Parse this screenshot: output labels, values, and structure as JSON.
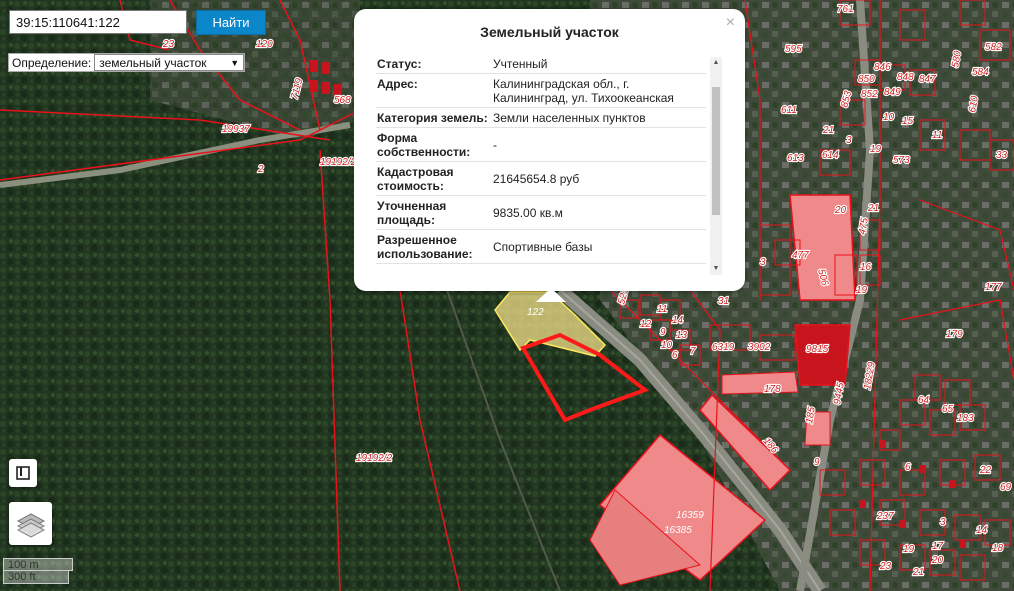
{
  "search": {
    "value": "39:15:110641:122",
    "button_label": "Найти"
  },
  "definition": {
    "label": "Определение:",
    "selected": "земельный участок"
  },
  "popup": {
    "title": "Земельный участок",
    "close": "×",
    "rows": [
      {
        "key": "Статус:",
        "value": "Учтенный"
      },
      {
        "key": "Адрес:",
        "value": "Калининградская обл., г. Калининград, ул. Тихоокеанская"
      },
      {
        "key": "Категория земель:",
        "value": "Земли населенных пунктов"
      },
      {
        "key": "Форма собственности:",
        "value": "-"
      },
      {
        "key": "Кадастровая стоимость:",
        "value": "21645654.8 руб"
      },
      {
        "key": "Уточненная площадь:",
        "value": "9835.00 кв.м"
      },
      {
        "key": "Разрешенное использование:",
        "value": "Спортивные базы"
      }
    ]
  },
  "map_labels": [
    "23",
    "120",
    "7119",
    "568",
    "19937",
    "19192/2",
    "2",
    "122",
    "19192/2",
    "595",
    "761",
    "611",
    "613",
    "614",
    "21",
    "3",
    "19",
    "573",
    "846",
    "848",
    "847",
    "850",
    "852",
    "849",
    "853",
    "10",
    "15",
    "11",
    "580",
    "582",
    "584",
    "33",
    "610",
    "20",
    "477",
    "506",
    "475",
    "16",
    "19",
    "21",
    "3",
    "523",
    "12",
    "11",
    "14",
    "13",
    "10",
    "6",
    "7",
    "9",
    "31",
    "6319",
    "3902",
    "9815",
    "178",
    "185",
    "186",
    "9445",
    "18229",
    "179",
    "177",
    "183",
    "64",
    "65",
    "9",
    "6",
    "16359",
    "16385",
    "237",
    "23",
    "19",
    "17",
    "20",
    "21",
    "22",
    "69",
    "3",
    "14",
    "18",
    "5"
  ],
  "scale": {
    "metric": "100 m",
    "imperial": "300 ft"
  },
  "colors": {
    "parcel_border": "#e8121b",
    "selected_fill": "#f3e28a",
    "building_fill": "#f08a8a",
    "button_bg": "#0b86c9"
  },
  "icons": {
    "bookmark": "bookmark-icon",
    "layers": "layers-icon"
  }
}
